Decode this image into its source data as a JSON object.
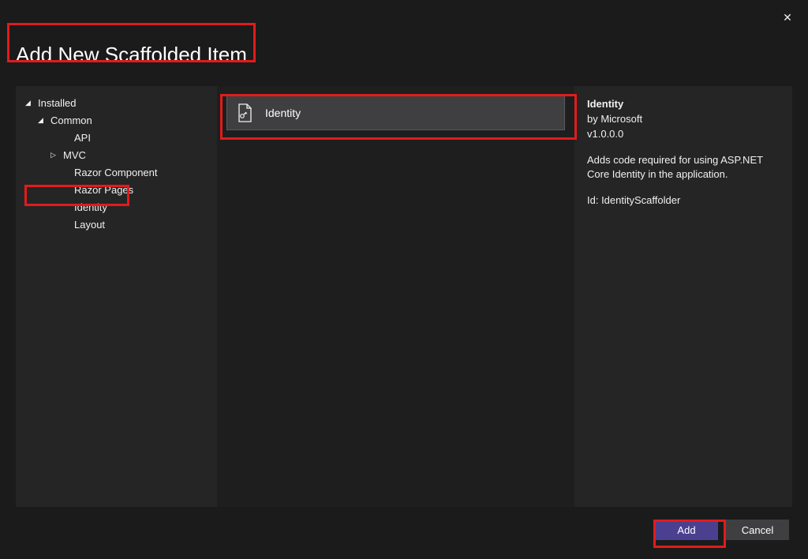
{
  "title": "Add New Scaffolded Item",
  "close_symbol": "✕",
  "sidebar": {
    "installed_label": "Installed",
    "common_label": "Common",
    "items": [
      {
        "label": "API",
        "has_children": false
      },
      {
        "label": "MVC",
        "has_children": true
      },
      {
        "label": "Razor Component",
        "has_children": false
      },
      {
        "label": "Razor Pages",
        "has_children": false
      },
      {
        "label": "Identity",
        "has_children": false
      },
      {
        "label": "Layout",
        "has_children": false
      }
    ]
  },
  "list": {
    "items": [
      {
        "label": "Identity"
      }
    ]
  },
  "details": {
    "title": "Identity",
    "by_line": "by Microsoft",
    "version": "v1.0.0.0",
    "description": "Adds code required for using ASP.NET Core Identity in the application.",
    "id_line": "Id: IdentityScaffolder"
  },
  "footer": {
    "add_label": "Add",
    "cancel_label": "Cancel"
  }
}
